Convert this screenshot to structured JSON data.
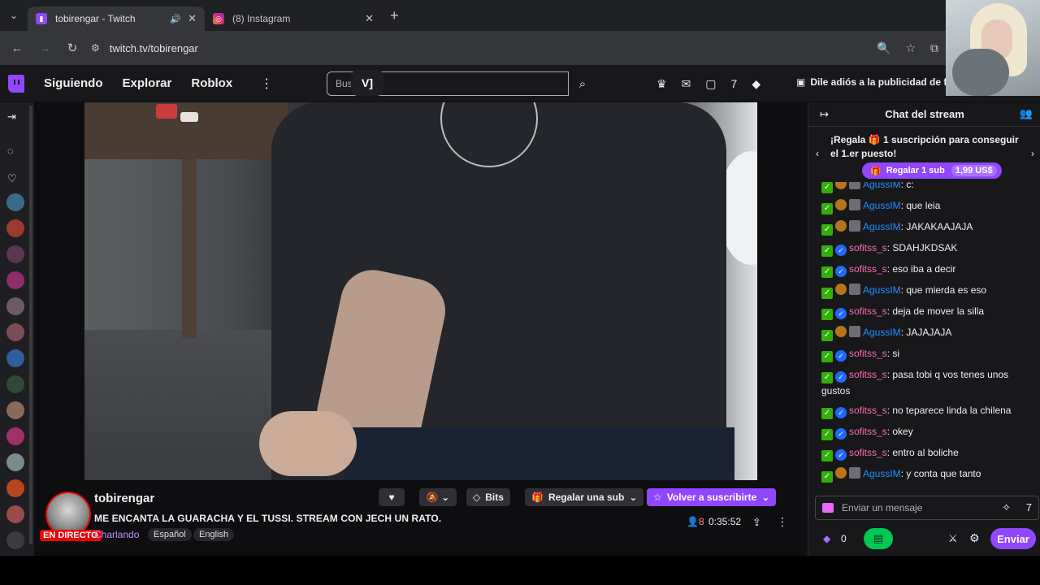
{
  "browser": {
    "tabs": [
      {
        "title": "tobirengar - Twitch",
        "active": true,
        "favicon": "twitch-icon"
      },
      {
        "title": "(8) Instagram",
        "active": false,
        "favicon": "instagram-icon"
      }
    ],
    "url": "twitch.tv/tobirengar"
  },
  "nav": {
    "links": [
      "Siguiendo",
      "Explorar",
      "Roblox"
    ],
    "search_placeholder": "Bus",
    "search_overlay_logo": "V]",
    "ad_notice": "Dile adiós a la publicidad de for"
  },
  "stream": {
    "channel": "tobirengar",
    "title": "ME ENCANTA LA GUARACHA Y EL TUSSI. STREAM CON JECH UN RATO.",
    "category": "Charlando",
    "tags": [
      "Español",
      "English"
    ],
    "live_label": "EN DIRECTO",
    "viewers": "8",
    "uptime": "0:35:52",
    "buttons": {
      "bits": "Bits",
      "gift": "Regalar una sub",
      "resub": "Volver a suscribirte"
    }
  },
  "chat": {
    "header": "Chat del stream",
    "gift_banner": {
      "text": "¡Regala 🎁 1 suscripción para conseguir el 1.er puesto!",
      "button": "Regalar 1 sub",
      "price": "1,99 US$"
    },
    "messages": [
      {
        "user": "AgussIM",
        "text": "c:"
      },
      {
        "user": "AgussIM",
        "text": "que leia"
      },
      {
        "user": "AgussIM",
        "text": "JAKAKAAJAJA"
      },
      {
        "user": "sofitss_s",
        "text": "SDAHJKDSAK"
      },
      {
        "user": "sofitss_s",
        "text": "eso iba a decir"
      },
      {
        "user": "AgussIM",
        "text": "que mierda es eso"
      },
      {
        "user": "sofitss_s",
        "text": "deja de mover la silla"
      },
      {
        "user": "AgussIM",
        "text": "JAJAJAJA"
      },
      {
        "user": "sofitss_s",
        "text": "si"
      },
      {
        "user": "sofitss_s",
        "text": "pasa tobi q vos tenes unos gustos"
      },
      {
        "user": "sofitss_s",
        "text": "no teparece linda la chilena"
      },
      {
        "user": "sofitss_s",
        "text": "okey"
      },
      {
        "user": "sofitss_s",
        "text": "entro al boliche"
      },
      {
        "user": "AgussIM",
        "text": "y conta que tanto"
      }
    ],
    "input_placeholder": "Enviar un mensaje",
    "bits_count": "0",
    "send_label": "Enviar"
  },
  "colors": {
    "twitch_purple": "#9147ff",
    "live_red": "#eb0400",
    "chat_user_agus": "#1e90ff",
    "chat_user_sofi": "#ff69b4"
  }
}
